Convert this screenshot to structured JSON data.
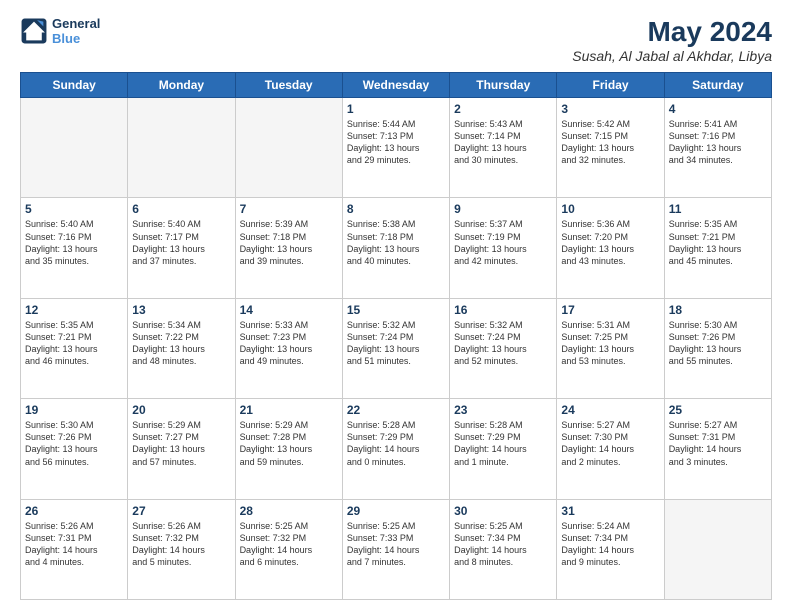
{
  "header": {
    "logo_line1": "General",
    "logo_line2": "Blue",
    "month_year": "May 2024",
    "location": "Susah, Al Jabal al Akhdar, Libya"
  },
  "days_of_week": [
    "Sunday",
    "Monday",
    "Tuesday",
    "Wednesday",
    "Thursday",
    "Friday",
    "Saturday"
  ],
  "weeks": [
    [
      {
        "day": "",
        "info": ""
      },
      {
        "day": "",
        "info": ""
      },
      {
        "day": "",
        "info": ""
      },
      {
        "day": "1",
        "info": "Sunrise: 5:44 AM\nSunset: 7:13 PM\nDaylight: 13 hours\nand 29 minutes."
      },
      {
        "day": "2",
        "info": "Sunrise: 5:43 AM\nSunset: 7:14 PM\nDaylight: 13 hours\nand 30 minutes."
      },
      {
        "day": "3",
        "info": "Sunrise: 5:42 AM\nSunset: 7:15 PM\nDaylight: 13 hours\nand 32 minutes."
      },
      {
        "day": "4",
        "info": "Sunrise: 5:41 AM\nSunset: 7:16 PM\nDaylight: 13 hours\nand 34 minutes."
      }
    ],
    [
      {
        "day": "5",
        "info": "Sunrise: 5:40 AM\nSunset: 7:16 PM\nDaylight: 13 hours\nand 35 minutes."
      },
      {
        "day": "6",
        "info": "Sunrise: 5:40 AM\nSunset: 7:17 PM\nDaylight: 13 hours\nand 37 minutes."
      },
      {
        "day": "7",
        "info": "Sunrise: 5:39 AM\nSunset: 7:18 PM\nDaylight: 13 hours\nand 39 minutes."
      },
      {
        "day": "8",
        "info": "Sunrise: 5:38 AM\nSunset: 7:18 PM\nDaylight: 13 hours\nand 40 minutes."
      },
      {
        "day": "9",
        "info": "Sunrise: 5:37 AM\nSunset: 7:19 PM\nDaylight: 13 hours\nand 42 minutes."
      },
      {
        "day": "10",
        "info": "Sunrise: 5:36 AM\nSunset: 7:20 PM\nDaylight: 13 hours\nand 43 minutes."
      },
      {
        "day": "11",
        "info": "Sunrise: 5:35 AM\nSunset: 7:21 PM\nDaylight: 13 hours\nand 45 minutes."
      }
    ],
    [
      {
        "day": "12",
        "info": "Sunrise: 5:35 AM\nSunset: 7:21 PM\nDaylight: 13 hours\nand 46 minutes."
      },
      {
        "day": "13",
        "info": "Sunrise: 5:34 AM\nSunset: 7:22 PM\nDaylight: 13 hours\nand 48 minutes."
      },
      {
        "day": "14",
        "info": "Sunrise: 5:33 AM\nSunset: 7:23 PM\nDaylight: 13 hours\nand 49 minutes."
      },
      {
        "day": "15",
        "info": "Sunrise: 5:32 AM\nSunset: 7:24 PM\nDaylight: 13 hours\nand 51 minutes."
      },
      {
        "day": "16",
        "info": "Sunrise: 5:32 AM\nSunset: 7:24 PM\nDaylight: 13 hours\nand 52 minutes."
      },
      {
        "day": "17",
        "info": "Sunrise: 5:31 AM\nSunset: 7:25 PM\nDaylight: 13 hours\nand 53 minutes."
      },
      {
        "day": "18",
        "info": "Sunrise: 5:30 AM\nSunset: 7:26 PM\nDaylight: 13 hours\nand 55 minutes."
      }
    ],
    [
      {
        "day": "19",
        "info": "Sunrise: 5:30 AM\nSunset: 7:26 PM\nDaylight: 13 hours\nand 56 minutes."
      },
      {
        "day": "20",
        "info": "Sunrise: 5:29 AM\nSunset: 7:27 PM\nDaylight: 13 hours\nand 57 minutes."
      },
      {
        "day": "21",
        "info": "Sunrise: 5:29 AM\nSunset: 7:28 PM\nDaylight: 13 hours\nand 59 minutes."
      },
      {
        "day": "22",
        "info": "Sunrise: 5:28 AM\nSunset: 7:29 PM\nDaylight: 14 hours\nand 0 minutes."
      },
      {
        "day": "23",
        "info": "Sunrise: 5:28 AM\nSunset: 7:29 PM\nDaylight: 14 hours\nand 1 minute."
      },
      {
        "day": "24",
        "info": "Sunrise: 5:27 AM\nSunset: 7:30 PM\nDaylight: 14 hours\nand 2 minutes."
      },
      {
        "day": "25",
        "info": "Sunrise: 5:27 AM\nSunset: 7:31 PM\nDaylight: 14 hours\nand 3 minutes."
      }
    ],
    [
      {
        "day": "26",
        "info": "Sunrise: 5:26 AM\nSunset: 7:31 PM\nDaylight: 14 hours\nand 4 minutes."
      },
      {
        "day": "27",
        "info": "Sunrise: 5:26 AM\nSunset: 7:32 PM\nDaylight: 14 hours\nand 5 minutes."
      },
      {
        "day": "28",
        "info": "Sunrise: 5:25 AM\nSunset: 7:32 PM\nDaylight: 14 hours\nand 6 minutes."
      },
      {
        "day": "29",
        "info": "Sunrise: 5:25 AM\nSunset: 7:33 PM\nDaylight: 14 hours\nand 7 minutes."
      },
      {
        "day": "30",
        "info": "Sunrise: 5:25 AM\nSunset: 7:34 PM\nDaylight: 14 hours\nand 8 minutes."
      },
      {
        "day": "31",
        "info": "Sunrise: 5:24 AM\nSunset: 7:34 PM\nDaylight: 14 hours\nand 9 minutes."
      },
      {
        "day": "",
        "info": ""
      }
    ]
  ]
}
